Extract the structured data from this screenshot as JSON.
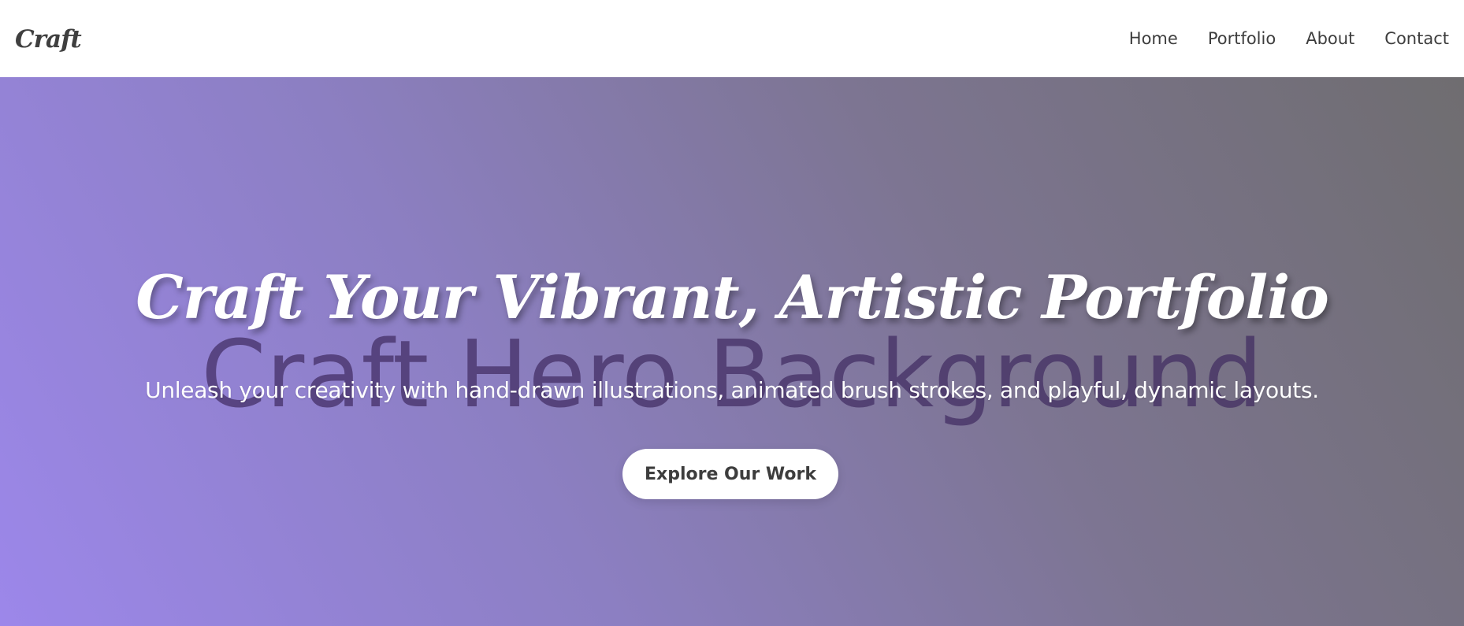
{
  "header": {
    "logo": "Craft",
    "nav": [
      {
        "label": "Home"
      },
      {
        "label": "Portfolio"
      },
      {
        "label": "About"
      },
      {
        "label": "Contact"
      }
    ]
  },
  "hero": {
    "background_alt": "Craft Hero Background",
    "title": "Craft Your Vibrant, Artistic Portfolio",
    "subtitle": "Unleash your creativity with hand-drawn illustrations, animated brush strokes, and playful, dynamic layouts.",
    "cta_label": "Explore Our Work"
  },
  "colors": {
    "header_bg": "#ffffff",
    "text_dark": "#3d3d3d",
    "hero_gradient_start": "#9c87ea",
    "hero_gradient_end": "#6f6d70",
    "button_bg": "#ffffff"
  }
}
